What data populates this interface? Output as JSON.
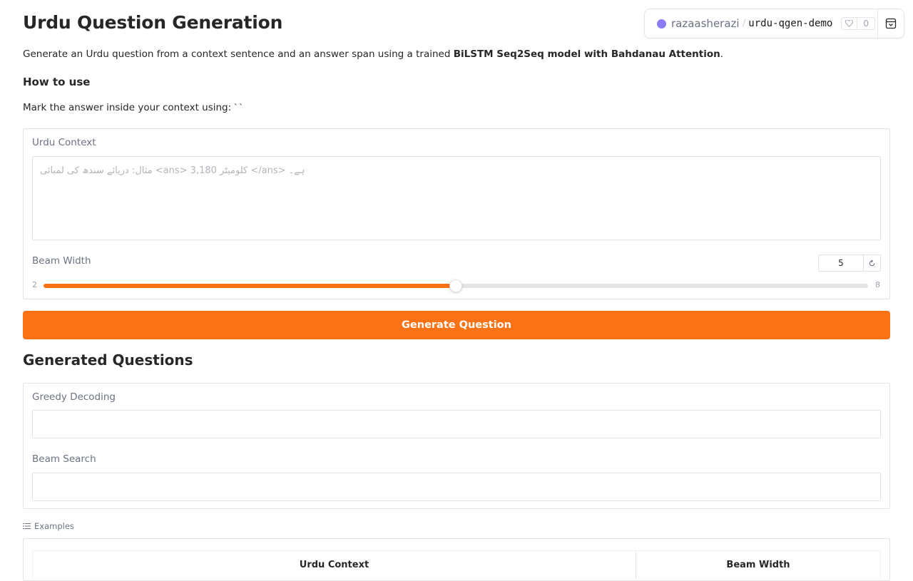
{
  "header": {
    "title": "Urdu Question Generation",
    "description_pre": "Generate an Urdu question from a context sentence and an answer span using a trained ",
    "description_bold": "BiLSTM Seq2Seq model with Bahdanau Attention",
    "description_post": ".",
    "howto_heading": "How to use",
    "mark_text": "Mark the answer inside your context using:",
    "mark_code": "``"
  },
  "space_badge": {
    "user": "razaasherazi",
    "separator": "/",
    "repo": "urdu-qgen-demo",
    "likes": "0"
  },
  "inputs": {
    "context_label": "Urdu Context",
    "context_placeholder": "مثال: دریائے سندھ کی لمبائی <ans> 3,180 کلومیٹر </ans> ہے۔",
    "context_value": "",
    "beam_label": "Beam Width",
    "beam_value": "5",
    "beam_reset_icon": "reset-icon",
    "beam_min": "2",
    "beam_max": "8",
    "beam_fraction": 0.5
  },
  "actions": {
    "generate_label": "Generate Question"
  },
  "outputs": {
    "heading": "Generated Questions",
    "greedy_label": "Greedy Decoding",
    "greedy_value": "",
    "beam_label": "Beam Search",
    "beam_value": ""
  },
  "examples": {
    "label": "Examples",
    "columns": [
      "Urdu Context",
      "Beam Width"
    ]
  },
  "colors": {
    "accent": "#f97316",
    "border": "#e4e4e7",
    "muted_text": "#6b7280"
  }
}
